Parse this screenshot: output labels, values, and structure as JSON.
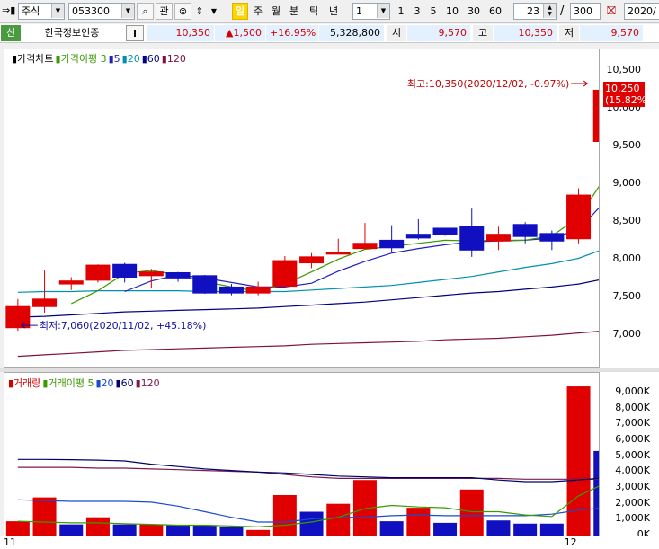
{
  "toolbar": {
    "market": "주식",
    "code": "053300",
    "btn_gwan": "관",
    "periods": [
      "일",
      "주",
      "월",
      "분",
      "틱",
      "년"
    ],
    "interval_value": "1",
    "quick": [
      "1",
      "3",
      "5",
      "10",
      "30",
      "60"
    ],
    "count": "23",
    "slash": "/",
    "total": "300",
    "date": "2020/"
  },
  "info": {
    "badge": "신",
    "name": "한국정보인증",
    "i_label": "i",
    "price": "10,350",
    "change": "▲1,500",
    "rate": "+16.95%",
    "volume": "5,328,800",
    "open_label": "시",
    "open": "9,570",
    "high_label": "고",
    "high": "10,350",
    "low_label": "저",
    "low": "9,570"
  },
  "colors": {
    "up": "#e00000",
    "down": "#1010c0",
    "ma3": "#3a9a00",
    "ma5": "#2020c0",
    "ma20": "#0090b0",
    "ma60": "#000080",
    "ma120": "#801040",
    "vma5": "#3a9a00",
    "vma20": "#1a4ad0",
    "vma60": "#00006a",
    "vma120": "#7a1a50"
  },
  "chart_data": [
    {
      "type": "candlestick",
      "legend": [
        {
          "text": "가격차트",
          "color": "#000"
        },
        {
          "text": "가격이평 3",
          "color": "#3a9a00"
        },
        {
          "text": "5",
          "color": "#2020c0"
        },
        {
          "text": "20",
          "color": "#0090b0"
        },
        {
          "text": "60",
          "color": "#000080"
        },
        {
          "text": "120",
          "color": "#801040"
        }
      ],
      "ylim": [
        6620,
        10720
      ],
      "yticks": [
        7000,
        7500,
        8000,
        8500,
        9000,
        9500,
        10000,
        10500
      ],
      "ytick_labels": [
        "7,000",
        "7,500",
        "8,000",
        "8,500",
        "9,000",
        "9,500",
        "10,000",
        "10,500"
      ],
      "x_labels": [
        {
          "i": 0,
          "text": "11"
        },
        {
          "i": 21,
          "text": "12"
        }
      ],
      "candles": [
        {
          "o": 7100,
          "h": 7480,
          "l": 7060,
          "c": 7380
        },
        {
          "o": 7380,
          "h": 7870,
          "l": 7300,
          "c": 7480
        },
        {
          "o": 7680,
          "h": 7770,
          "l": 7600,
          "c": 7720
        },
        {
          "o": 7730,
          "h": 7940,
          "l": 7700,
          "c": 7930
        },
        {
          "o": 7940,
          "h": 7960,
          "l": 7700,
          "c": 7770
        },
        {
          "o": 7790,
          "h": 7880,
          "l": 7620,
          "c": 7840
        },
        {
          "o": 7830,
          "h": 7840,
          "l": 7710,
          "c": 7760
        },
        {
          "o": 7790,
          "h": 7800,
          "l": 7550,
          "c": 7560
        },
        {
          "o": 7640,
          "h": 7680,
          "l": 7530,
          "c": 7560
        },
        {
          "o": 7560,
          "h": 7710,
          "l": 7530,
          "c": 7640
        },
        {
          "o": 7650,
          "h": 8050,
          "l": 7640,
          "c": 7990
        },
        {
          "o": 7960,
          "h": 8090,
          "l": 7890,
          "c": 8040
        },
        {
          "o": 8100,
          "h": 8280,
          "l": 8080,
          "c": 8100
        },
        {
          "o": 8150,
          "h": 8490,
          "l": 8150,
          "c": 8220
        },
        {
          "o": 8260,
          "h": 8460,
          "l": 8100,
          "c": 8160
        },
        {
          "o": 8340,
          "h": 8540,
          "l": 8270,
          "c": 8290
        },
        {
          "o": 8420,
          "h": 8420,
          "l": 8320,
          "c": 8340
        },
        {
          "o": 8440,
          "h": 8680,
          "l": 8040,
          "c": 8130
        },
        {
          "o": 8250,
          "h": 8440,
          "l": 8130,
          "c": 8340
        },
        {
          "o": 8470,
          "h": 8500,
          "l": 8220,
          "c": 8310
        },
        {
          "o": 8350,
          "h": 8390,
          "l": 8130,
          "c": 8250
        },
        {
          "o": 8280,
          "h": 8950,
          "l": 8220,
          "c": 8860
        },
        {
          "o": 9570,
          "h": 10350,
          "l": 9570,
          "c": 10250
        }
      ],
      "ma3": [
        null,
        null,
        7420,
        7590,
        7820,
        7860,
        7800,
        7710,
        7640,
        7580,
        7680,
        7840,
        8010,
        8140,
        8180,
        8220,
        8260,
        8250,
        8260,
        8260,
        8320,
        8560,
        9100
      ],
      "ma5": [
        null,
        null,
        null,
        null,
        7580,
        7720,
        7800,
        7760,
        7700,
        7640,
        7640,
        7690,
        7850,
        7980,
        8090,
        8150,
        8200,
        8240,
        8250,
        8260,
        8290,
        8400,
        8780
      ],
      "ma20": [
        7570,
        7580,
        7580,
        7590,
        7590,
        7590,
        7590,
        7580,
        7580,
        7580,
        7580,
        7600,
        7620,
        7640,
        7660,
        7700,
        7740,
        7780,
        7840,
        7900,
        7950,
        8020,
        8150
      ],
      "ma60": [
        7240,
        7250,
        7270,
        7290,
        7310,
        7320,
        7330,
        7340,
        7350,
        7360,
        7380,
        7400,
        7420,
        7440,
        7470,
        7500,
        7530,
        7560,
        7580,
        7610,
        7640,
        7680,
        7750
      ],
      "ma120": [
        6720,
        6740,
        6760,
        6780,
        6800,
        6810,
        6820,
        6830,
        6840,
        6850,
        6860,
        6880,
        6890,
        6900,
        6910,
        6920,
        6940,
        6950,
        6960,
        6980,
        7000,
        7030,
        7060
      ],
      "annotations": {
        "high": "최고:10,350(2020/12/02, -0.97%)",
        "low": "최저:7,060(2020/11/02, +45.18%)",
        "last_price": "10,250",
        "last_rate": "(15.82%)"
      }
    },
    {
      "type": "bar",
      "legend": [
        {
          "text": "거래량",
          "color": "#d40000"
        },
        {
          "text": "거래이평 5",
          "color": "#3a9a00"
        },
        {
          "text": "20",
          "color": "#1a4ad0"
        },
        {
          "text": "60",
          "color": "#00006a"
        },
        {
          "text": "120",
          "color": "#7a1a50"
        }
      ],
      "ylim": [
        0,
        9800
      ],
      "yticks": [
        0,
        1000,
        2000,
        3000,
        4000,
        5000,
        6000,
        7000,
        8000,
        9000
      ],
      "ytick_labels": [
        "0K",
        "1,000K",
        "2,000K",
        "3,000K",
        "4,000K",
        "5,000K",
        "6,000K",
        "7,000K",
        "8,000K",
        "9,000K"
      ],
      "values": [
        900,
        2400,
        700,
        1150,
        700,
        700,
        650,
        650,
        550,
        350,
        2550,
        1500,
        2000,
        3500,
        900,
        1750,
        800,
        2900,
        950,
        750,
        750,
        9400,
        5330
      ],
      "up": [
        true,
        true,
        false,
        true,
        false,
        true,
        false,
        false,
        false,
        true,
        true,
        false,
        true,
        true,
        false,
        true,
        false,
        true,
        false,
        false,
        false,
        true,
        false
      ],
      "vma5": [
        900,
        850,
        800,
        800,
        750,
        700,
        650,
        650,
        600,
        550,
        650,
        850,
        1150,
        1700,
        1900,
        1800,
        1750,
        1500,
        1500,
        1300,
        1200,
        2500,
        3300
      ],
      "vma20": [
        2250,
        2200,
        2150,
        2150,
        2150,
        2100,
        1850,
        1500,
        1150,
        850,
        850,
        1050,
        1150,
        1150,
        1250,
        1300,
        1250,
        1250,
        1250,
        1250,
        1350,
        1600,
        1750
      ],
      "vma60": [
        4800,
        4800,
        4780,
        4750,
        4700,
        4500,
        4350,
        4200,
        4100,
        4000,
        3950,
        3850,
        3750,
        3700,
        3650,
        3650,
        3650,
        3650,
        3500,
        3400,
        3400,
        3500,
        3650
      ],
      "vma120": [
        4300,
        4300,
        4300,
        4250,
        4250,
        4200,
        4150,
        4100,
        4050,
        4000,
        3850,
        3700,
        3600,
        3600,
        3600,
        3600,
        3600,
        3600,
        3600,
        3550,
        3550,
        3550,
        3550
      ]
    }
  ]
}
